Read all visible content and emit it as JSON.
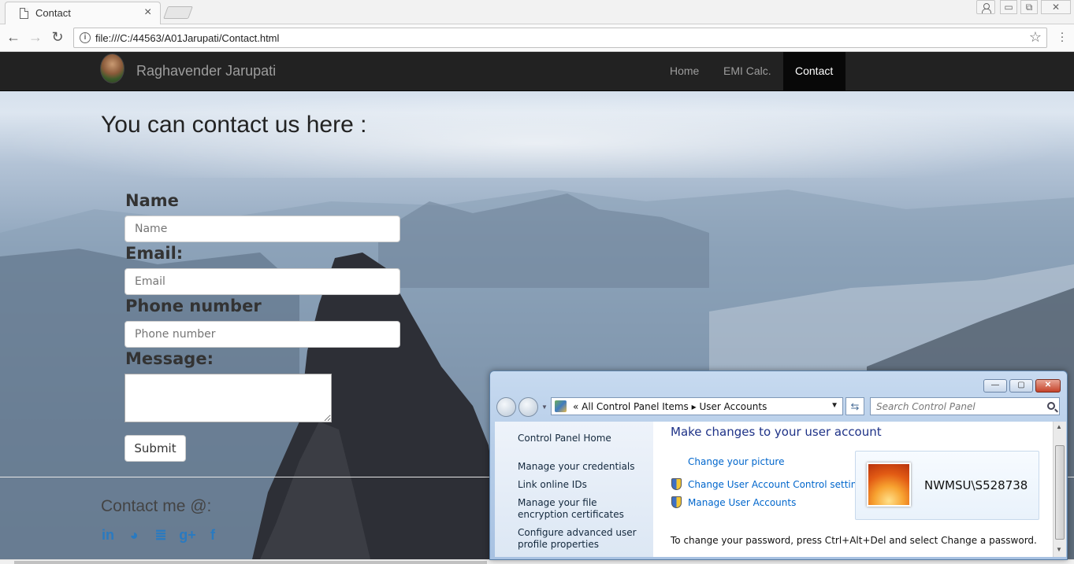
{
  "browser": {
    "tab_title": "Contact",
    "tab_close": "×",
    "url": "file:///C:/44563/A01Jarupati/Contact.html",
    "nav": {
      "back": "←",
      "forward": "→",
      "reload": "↻",
      "star": "☆"
    },
    "win": {
      "minimize": "▭",
      "restore": "⧉",
      "close": "✕"
    }
  },
  "site": {
    "brand": "Raghavender Jarupati",
    "nav": [
      {
        "label": "Home"
      },
      {
        "label": "EMI Calc."
      },
      {
        "label": "Contact",
        "active": true
      }
    ],
    "headline": "You can contact us here :",
    "form": {
      "name_label": "Name",
      "name_placeholder": "Name",
      "email_label": "Email:",
      "email_placeholder": "Email",
      "phone_label": "Phone number",
      "phone_placeholder": "Phone number",
      "message_label": "Message:",
      "submit": "Submit"
    },
    "footer": {
      "contact_me": "Contact me @:",
      "social": [
        {
          "icon": "linkedin-icon",
          "glyph": "in"
        },
        {
          "icon": "github-icon",
          "glyph": "◕"
        },
        {
          "icon": "stackoverflow-icon",
          "glyph": "≣"
        },
        {
          "icon": "googleplus-icon",
          "glyph": "g+"
        },
        {
          "icon": "facebook-icon",
          "glyph": "f"
        }
      ]
    }
  },
  "control_panel": {
    "breadcrumb": "«  All Control Panel Items  ▸  User Accounts",
    "search_placeholder": "Search Control Panel",
    "sidebar": [
      "Control Panel Home",
      "Manage your credentials",
      "Link online IDs",
      "Manage your file encryption certificates",
      "Configure advanced user profile properties"
    ],
    "heading": "Make changes to your user account",
    "links": {
      "change_picture": "Change your picture",
      "uac": "Change User Account Control settings",
      "manage": "Manage User Accounts"
    },
    "user_name": "NWMSU\\S528738",
    "footer_text": "To change your password, press Ctrl+Alt+Del and select Change a password.",
    "buttons": {
      "minimize": "—",
      "maximize": "▢",
      "close": "✕"
    }
  },
  "colors": {
    "navbar_bg": "#222222",
    "link_blue": "#0066cc",
    "social_blue": "#2a7ac0",
    "cp_heading": "#1e3287"
  }
}
